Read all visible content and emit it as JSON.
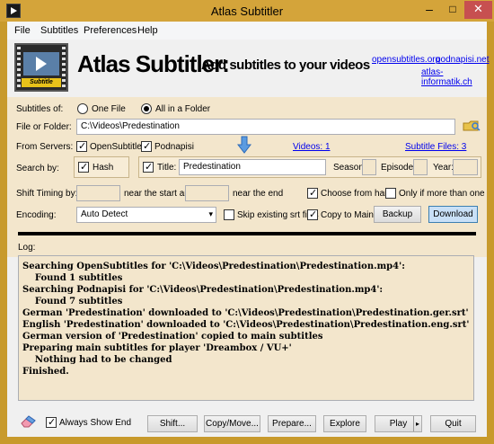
{
  "window": {
    "title": "Atlas Subtitler"
  },
  "menu": [
    "File",
    "Subtitles",
    "Preferences",
    "Help"
  ],
  "header": {
    "logo_label": "Subtitle",
    "brand": "Atlas Subtitler:",
    "tagline": "Add subtitles to your videos",
    "links": [
      "opensubtitles.org",
      "podnapisi.net",
      "atlas-informatik.ch"
    ]
  },
  "form": {
    "subtitles_of_label": "Subtitles of:",
    "one_file": "One File",
    "all_in_folder": "All in a Folder",
    "file_or_folder_label": "File or Folder:",
    "file_or_folder_value": "C:\\Videos\\Predestination",
    "from_servers_label": "From Servers:",
    "server_opensubtitles": "OpenSubtitles",
    "server_podnapisi": "Podnapisi",
    "videos_link": "Videos: 1",
    "subtitle_files_link": "Subtitle Files: 3",
    "search_by_label": "Search by:",
    "hash_label": "Hash",
    "title_label": "Title:",
    "title_value": "Predestination",
    "season_label": "Season:",
    "episode_label": "Episode:",
    "year_label": "Year:",
    "shift_timing_label": "Shift Timing by:",
    "near_start_label": "near the start and",
    "near_end_label": "near the end",
    "choose_from_hand": "Choose from hand",
    "only_if_more": "Only if more than one",
    "encoding_label": "Encoding:",
    "encoding_value": "Auto Detect",
    "skip_existing": "Skip existing srt files",
    "copy_to_main": "Copy to Main",
    "backup_button": "Backup",
    "download_button": "Download"
  },
  "log": {
    "label": "Log:",
    "lines": [
      "Searching OpenSubtitles for 'C:\\Videos\\Predestination\\Predestination.mp4':",
      "    Found 1 subtitles",
      "Searching Podnapisi for 'C:\\Videos\\Predestination\\Predestination.mp4':",
      "    Found 7 subtitles",
      "German 'Predestination' downloaded to 'C:\\Videos\\Predestination\\Predestination.ger.srt'",
      "English 'Predestination' downloaded to 'C:\\Videos\\Predestination\\Predestination.eng.srt'",
      "German version of 'Predestination' copied to main subtitles",
      "Preparing main subtitles for player 'Dreambox / VU+'",
      "    Nothing had to be changed",
      "Finished."
    ]
  },
  "footer": {
    "always_show_end": "Always Show End",
    "buttons": [
      "Shift...",
      "Copy/Move...",
      "Prepare...",
      "Explore",
      "Play",
      "Quit"
    ]
  }
}
